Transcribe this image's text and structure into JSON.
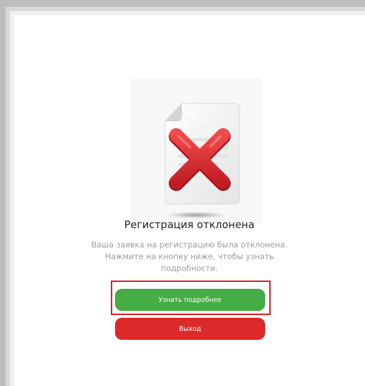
{
  "dialog": {
    "illustration_icon": "document-rejected-icon",
    "title": "Регистрация отклонена",
    "description": "Ваша заявка на регистрацию была отклонена. Нажмите на кнопку ниже, чтобы узнать подробности.",
    "more_button_label": "Узнать подробнее",
    "exit_button_label": "Выход"
  },
  "colors": {
    "primary_green": "#46ac46",
    "danger_red": "#dc2a2b",
    "highlight_red": "#d81a22",
    "title_text": "#1d1d1d",
    "muted_text": "#9a9a9a"
  }
}
